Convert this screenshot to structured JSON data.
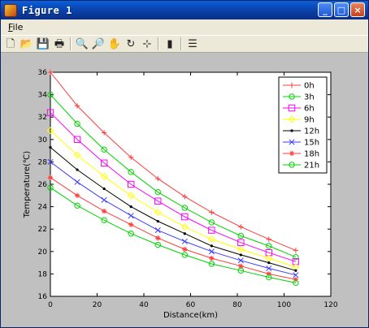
{
  "window": {
    "title": "Figure 1",
    "controls": {
      "minimize": "_",
      "maximize": "□",
      "close": "×"
    }
  },
  "menubar": {
    "file_label": "File",
    "file_underline": "F",
    "file_rest": "ile"
  },
  "toolbar": {
    "tools": [
      {
        "name": "new-figure-icon",
        "glyph": "🗋"
      },
      {
        "name": "open-file-icon",
        "glyph": "📂"
      },
      {
        "name": "save-icon",
        "glyph": "💾"
      },
      {
        "name": "print-icon",
        "glyph": "🖶"
      },
      {
        "name": "zoom-in-icon",
        "glyph": "🔍"
      },
      {
        "name": "zoom-out-icon",
        "glyph": "🔎"
      },
      {
        "name": "pan-icon",
        "glyph": "✋"
      },
      {
        "name": "rotate-3d-icon",
        "glyph": "↻"
      },
      {
        "name": "data-cursor-icon",
        "glyph": "⊹"
      },
      {
        "name": "colorbar-icon",
        "glyph": "▮"
      },
      {
        "name": "legend-icon",
        "glyph": "☰"
      }
    ]
  },
  "chart_data": {
    "type": "line",
    "title": "",
    "xlabel": "Distance(km)",
    "ylabel": "Temperature(℃)",
    "xlim": [
      0,
      120
    ],
    "ylim": [
      16,
      36
    ],
    "xticks": [
      0,
      20,
      40,
      60,
      80,
      100,
      120
    ],
    "yticks": [
      16,
      18,
      20,
      22,
      24,
      26,
      28,
      30,
      32,
      34,
      36
    ],
    "grid": false,
    "legend_position": "top-right",
    "x": [
      0,
      11.5,
      23,
      34.5,
      46,
      57.5,
      69,
      81.5,
      93.5,
      105
    ],
    "series": [
      {
        "name": "0h",
        "color": "#ff3b3b",
        "marker": "plus",
        "values": [
          36.0,
          33.0,
          30.6,
          28.4,
          26.5,
          24.9,
          23.5,
          22.2,
          21.1,
          20.1
        ]
      },
      {
        "name": "3h",
        "color": "#00d400",
        "marker": "circle",
        "values": [
          34.0,
          31.4,
          29.1,
          27.1,
          25.3,
          23.9,
          22.6,
          21.4,
          20.5,
          19.5
        ]
      },
      {
        "name": "6h",
        "color": "#ff00ff",
        "marker": "square",
        "values": [
          32.4,
          30.0,
          27.9,
          26.0,
          24.5,
          23.1,
          21.9,
          20.8,
          19.9,
          19.1
        ]
      },
      {
        "name": "9h",
        "color": "#ffff00",
        "marker": "diamond",
        "values": [
          30.8,
          28.6,
          26.7,
          25.0,
          23.5,
          22.2,
          21.1,
          20.2,
          19.4,
          18.6
        ]
      },
      {
        "name": "12h",
        "color": "#000000",
        "marker": "point",
        "values": [
          29.3,
          27.3,
          25.6,
          24.0,
          22.7,
          21.6,
          20.5,
          19.7,
          19.0,
          18.3
        ]
      },
      {
        "name": "15h",
        "color": "#3b3bff",
        "marker": "x",
        "values": [
          28.0,
          26.2,
          24.6,
          23.2,
          21.9,
          20.9,
          20.0,
          19.2,
          18.5,
          17.9
        ]
      },
      {
        "name": "18h",
        "color": "#ff3b3b",
        "marker": "star",
        "values": [
          26.6,
          25.0,
          23.6,
          22.4,
          21.2,
          20.2,
          19.4,
          18.7,
          18.0,
          17.5
        ]
      },
      {
        "name": "21h",
        "color": "#00d400",
        "marker": "circle",
        "values": [
          25.7,
          24.1,
          22.8,
          21.6,
          20.6,
          19.7,
          18.9,
          18.3,
          17.7,
          17.2
        ]
      }
    ]
  }
}
